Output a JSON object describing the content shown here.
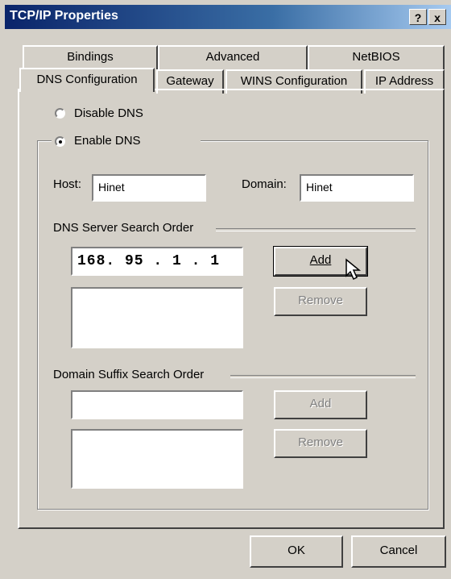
{
  "window": {
    "title": "TCP/IP Properties",
    "help_label": "?",
    "close_label": "x"
  },
  "tabs": {
    "row1": [
      "Bindings",
      "Advanced",
      "NetBIOS"
    ],
    "row2": [
      "DNS Configuration",
      "Gateway",
      "WINS Configuration",
      "IP Address"
    ],
    "active": "DNS Configuration"
  },
  "dns": {
    "disable_label": "Disable DNS",
    "enable_label": "Enable DNS",
    "selected": "Enable DNS",
    "host_label": "Host:",
    "host_value": "Hinet",
    "domain_label": "Domain:",
    "domain_value": "Hinet",
    "server_group_label": "DNS Server Search Order",
    "server_input_value": "168. 95 . 1 . 1",
    "server_add_label": "Add",
    "server_remove_label": "Remove",
    "suffix_group_label": "Domain Suffix Search Order",
    "suffix_add_label": "Add",
    "suffix_remove_label": "Remove"
  },
  "footer": {
    "ok_label": "OK",
    "cancel_label": "Cancel"
  },
  "colors": {
    "face": "#d4d0c8",
    "titlebar_start": "#0a246a",
    "titlebar_end": "#a6caf0"
  }
}
